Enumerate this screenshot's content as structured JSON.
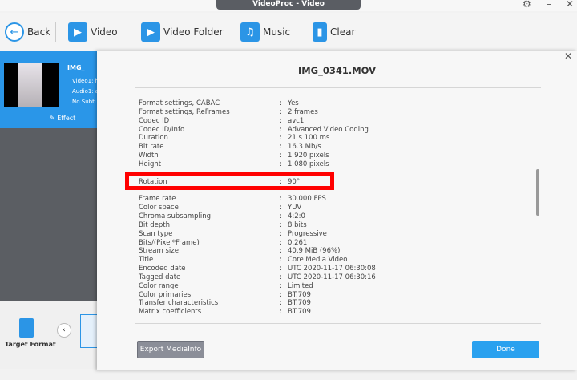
{
  "window": {
    "title": "VideoProc - Video"
  },
  "toolbar": {
    "back": "Back",
    "video": "Video",
    "video_folder": "Video Folder",
    "music": "Music",
    "clear": "Clear"
  },
  "left": {
    "file": "IMG_",
    "video": "Video1: h",
    "audio": "Audio1: a",
    "subs": "No Subti",
    "effect": "Effect",
    "target_format": "Target Format"
  },
  "dialog": {
    "title": "IMG_0341.MOV",
    "export": "Export MediaInfo",
    "done": "Done",
    "rows": [
      {
        "k": "Format settings, CABAC",
        "v": "Yes"
      },
      {
        "k": "Format settings, ReFrames",
        "v": "2 frames"
      },
      {
        "k": "Codec ID",
        "v": "avc1"
      },
      {
        "k": "Codec ID/Info",
        "v": "Advanced Video Coding"
      },
      {
        "k": "Duration",
        "v": "21 s 100 ms"
      },
      {
        "k": "Bit rate",
        "v": "16.3 Mb/s"
      },
      {
        "k": "Width",
        "v": "1 920 pixels"
      },
      {
        "k": "Height",
        "v": "1 080 pixels"
      },
      {
        "k": "",
        "v": ""
      },
      {
        "k": "Rotation",
        "v": "90°"
      },
      {
        "k": "",
        "v": ""
      },
      {
        "k": "Frame rate",
        "v": "30.000 FPS"
      },
      {
        "k": "Color space",
        "v": "YUV"
      },
      {
        "k": "Chroma subsampling",
        "v": "4:2:0"
      },
      {
        "k": "Bit depth",
        "v": "8 bits"
      },
      {
        "k": "Scan type",
        "v": "Progressive"
      },
      {
        "k": "Bits/(Pixel*Frame)",
        "v": "0.261"
      },
      {
        "k": "Stream size",
        "v": "40.9 MiB (96%)"
      },
      {
        "k": "Title",
        "v": "Core Media Video"
      },
      {
        "k": "Encoded date",
        "v": "UTC 2020-11-17 06:30:08"
      },
      {
        "k": "Tagged date",
        "v": "UTC 2020-11-17 06:30:16"
      },
      {
        "k": "Color range",
        "v": "Limited"
      },
      {
        "k": "Color primaries",
        "v": "BT.709"
      },
      {
        "k": "Transfer characteristics",
        "v": "BT.709"
      },
      {
        "k": "Matrix coefficients",
        "v": "BT.709"
      }
    ]
  }
}
